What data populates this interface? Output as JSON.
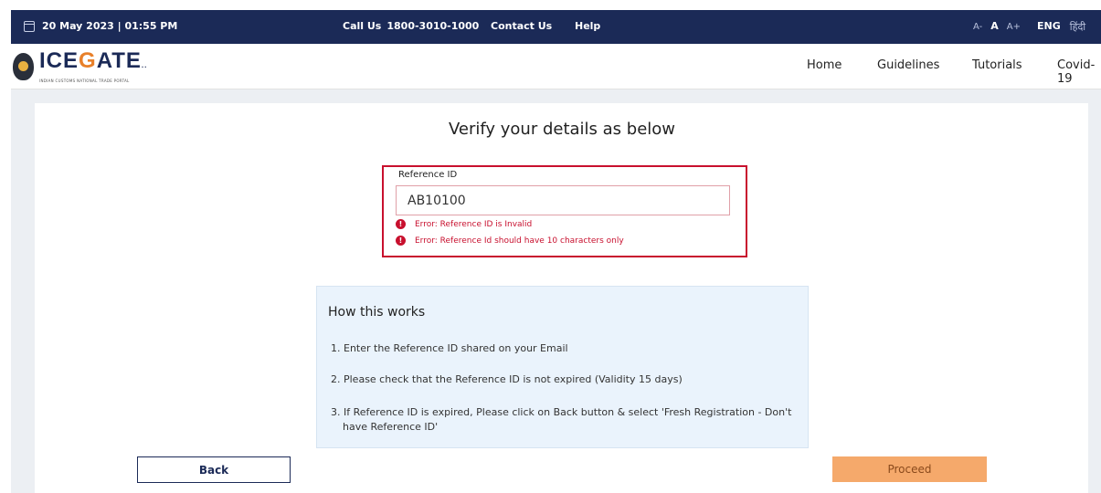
{
  "topbar": {
    "datetime": "20 May 2023 | 01:55 PM",
    "call_label": "Call Us",
    "call_number": "1800-3010-1000",
    "contact": "Contact Us",
    "help": "Help",
    "font_small": "A-",
    "font_normal": "A",
    "font_large": "A+",
    "lang_eng": "ENG",
    "lang_hindi": "हिंदी"
  },
  "logo": {
    "prefix": "ICE",
    "accent": "G",
    "suffix": "ATE",
    "tm": "..",
    "tagline": "INDIAN CUSTOMS NATIONAL TRADE PORTAL"
  },
  "nav": {
    "home": "Home",
    "guidelines": "Guidelines",
    "tutorials": "Tutorials",
    "covid": "Covid-19"
  },
  "main": {
    "title": "Verify your details as below",
    "ref_label": "Reference ID",
    "ref_value": "AB10100",
    "errors": [
      "Error: Reference ID is Invalid",
      "Error: Reference Id should have 10 characters only"
    ]
  },
  "how": {
    "title": "How this works",
    "items": [
      "1. Enter the Reference ID shared on your Email",
      "2. Please check that the Reference ID is not expired (Validity 15 days)",
      "3. If Reference ID is expired, Please click on Back button & select 'Fresh Registration - Don't have Reference ID'"
    ]
  },
  "buttons": {
    "back": "Back",
    "proceed": "Proceed"
  },
  "colors": {
    "header_bg": "#1b2a57",
    "error": "#c8102e",
    "proceed_bg": "#f5a96b",
    "info_bg": "#eaf3fc"
  }
}
